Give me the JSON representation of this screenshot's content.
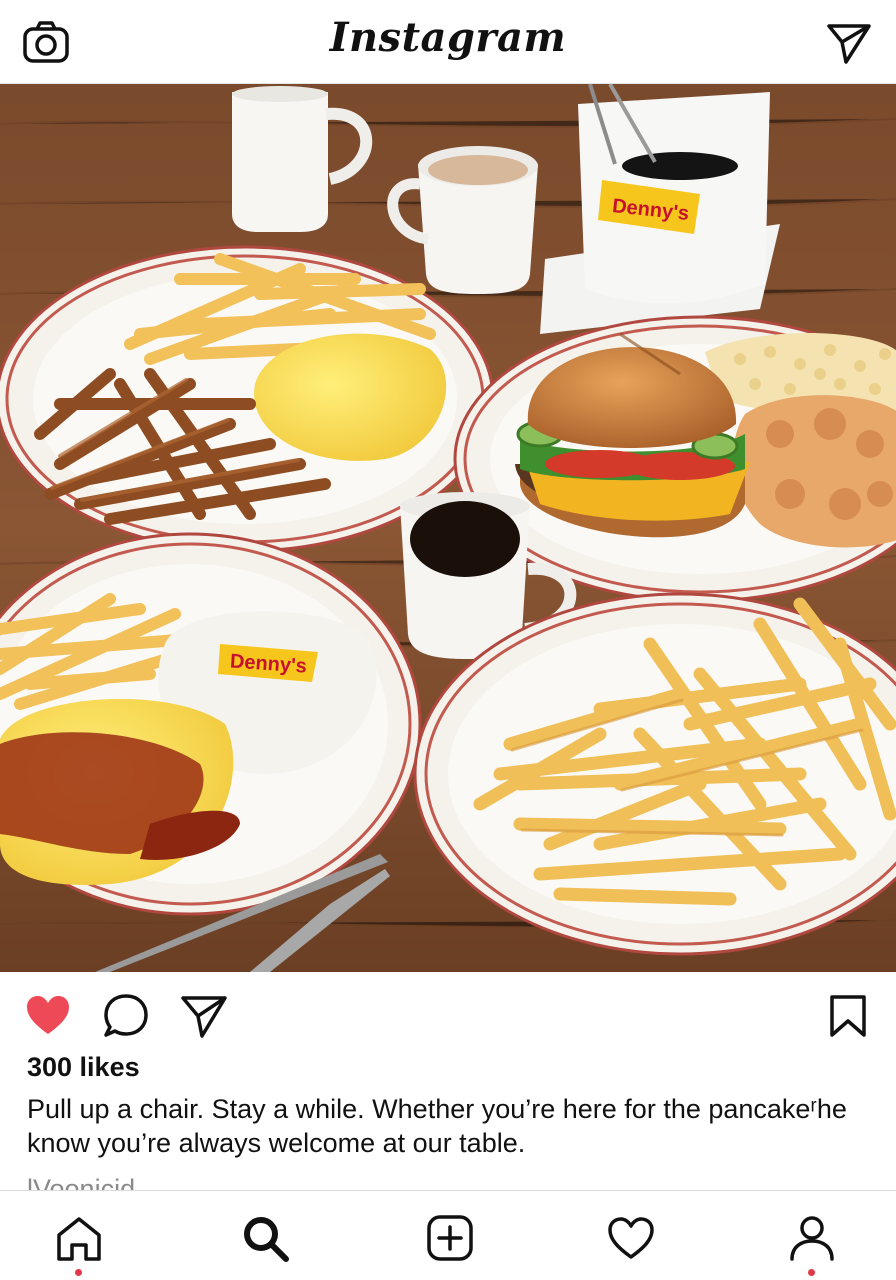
{
  "app": {
    "title": "Instagram"
  },
  "header": {
    "camera_icon": "camera-icon",
    "direct_icon": "paper-plane-icon"
  },
  "post": {
    "image_description_brand": "Denny's",
    "plate_logo_text": "Denny's",
    "cup_logo_text": "Denny's",
    "liked": true,
    "like_color": "#ed4956",
    "likes": "300 likes",
    "caption": "Pull up a chair. Stay a while. Whether you’re here for the pancakeʳhe know you’re always welcome at our table.",
    "more_text": "lVoonicid"
  },
  "actions": {
    "like_icon": "heart-filled-icon",
    "comment_icon": "comment-bubble-icon",
    "share_icon": "paper-plane-icon",
    "save_icon": "bookmark-icon"
  },
  "bottom_nav": {
    "items": [
      {
        "name": "home-icon",
        "notification": true
      },
      {
        "name": "search-icon",
        "notification": false
      },
      {
        "name": "add-post-icon",
        "notification": false
      },
      {
        "name": "activity-heart-icon",
        "notification": false
      },
      {
        "name": "profile-icon",
        "notification": true
      }
    ],
    "notification_color": "#e03a4a"
  }
}
